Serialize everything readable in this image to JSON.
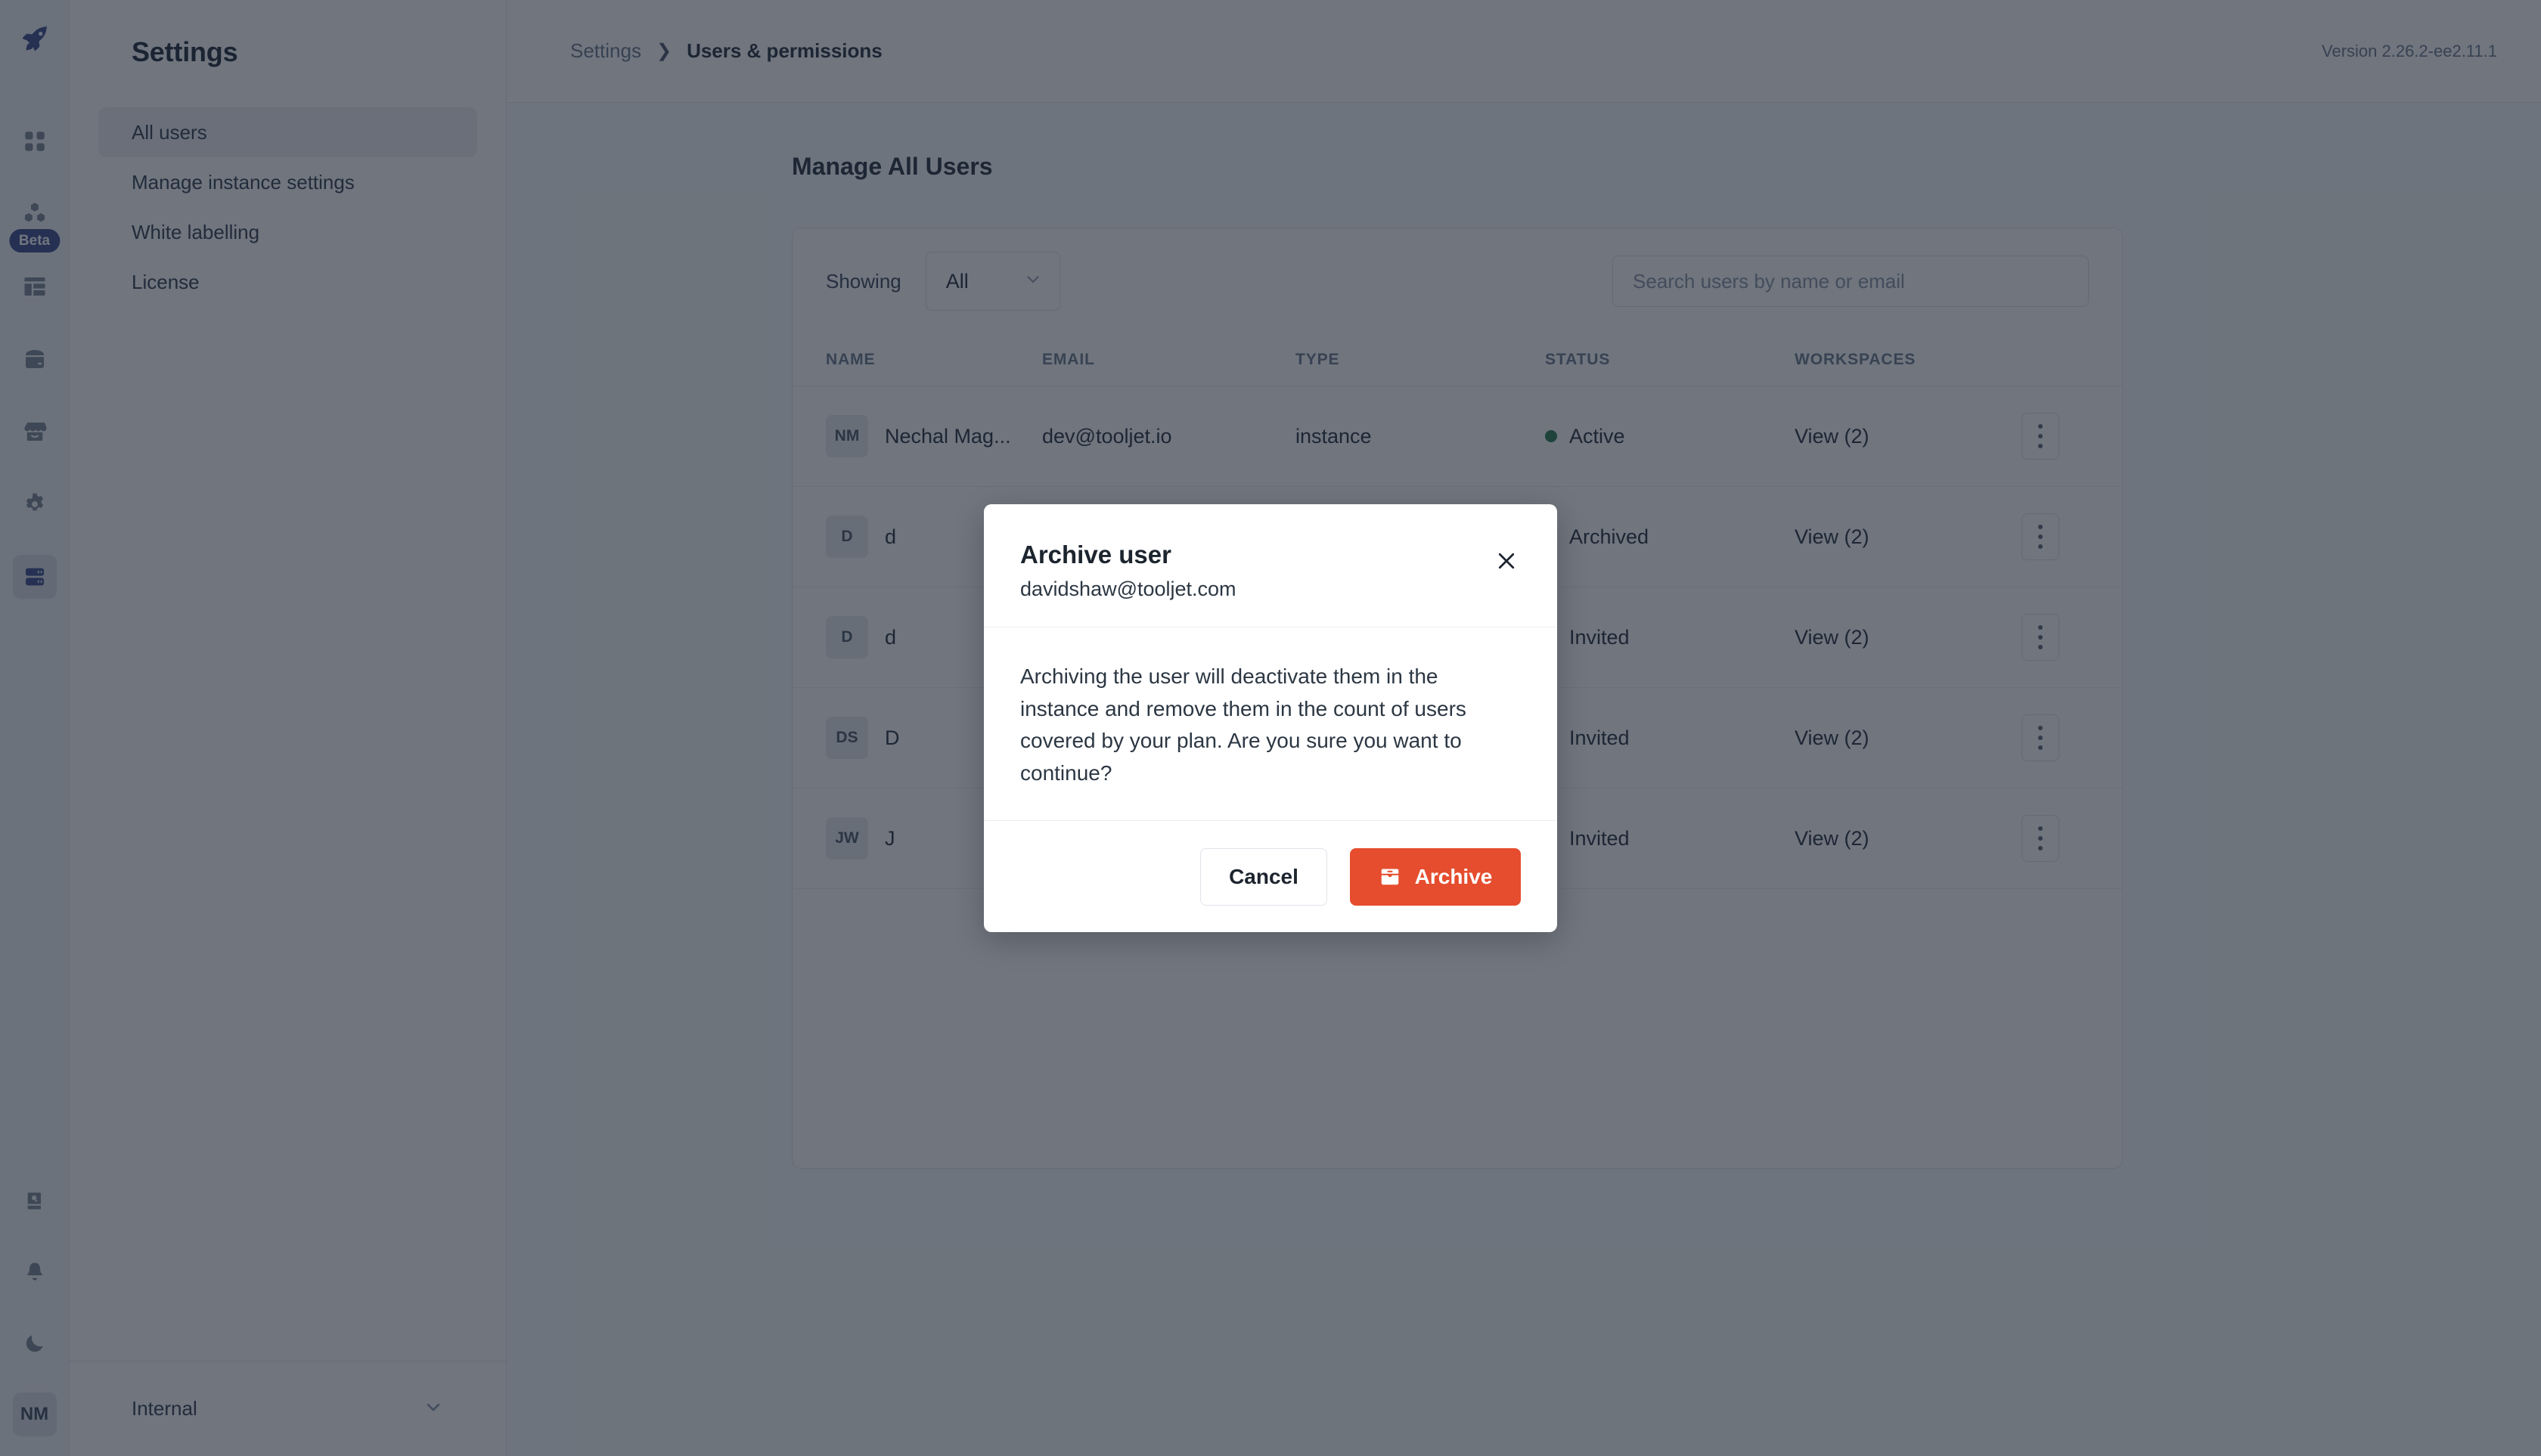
{
  "colors": {
    "brand_blue": "#3a4b8f",
    "accent_orange": "#e54d2e",
    "status_active": "#2a7d4f",
    "status_archived": "#a8333a",
    "status_invited": "#b07b24",
    "overlay": "#18212e"
  },
  "rail": {
    "logo_icon": "rocket-icon",
    "items": [
      {
        "icon": "grid-apps-icon",
        "active": false
      },
      {
        "icon": "hexagons-icon",
        "active": false,
        "badge": "Beta"
      },
      {
        "icon": "layout-dashboard-icon",
        "active": false
      },
      {
        "icon": "database-icon",
        "active": false
      },
      {
        "icon": "storefront-icon",
        "active": false
      },
      {
        "icon": "gear-icon",
        "active": false
      },
      {
        "icon": "server-rack-icon",
        "active": true
      }
    ],
    "bottom_items": [
      {
        "icon": "book-search-icon"
      },
      {
        "icon": "bell-icon"
      },
      {
        "icon": "moon-icon"
      }
    ],
    "avatar_initials": "NM"
  },
  "sidebar": {
    "title": "Settings",
    "items": [
      {
        "label": "All users",
        "active": true
      },
      {
        "label": "Manage instance settings",
        "active": false
      },
      {
        "label": "White labelling",
        "active": false
      },
      {
        "label": "License",
        "active": false
      }
    ],
    "workspace": {
      "name": "Internal",
      "chevron_icon": "chevron-down-icon"
    }
  },
  "topbar": {
    "breadcrumb_root": "Settings",
    "breadcrumb_separator": "❯",
    "breadcrumb_current": "Users & permissions",
    "version": "Version 2.26.2-ee2.11.1"
  },
  "main": {
    "page_title": "Manage All Users",
    "toolbar": {
      "showing_label": "Showing",
      "filter_value": "All",
      "filter_chevron_icon": "chevron-down-icon",
      "search_placeholder": "Search users by name or email",
      "search_value": ""
    },
    "table": {
      "columns": [
        "NAME",
        "EMAIL",
        "TYPE",
        "STATUS",
        "WORKSPACES"
      ],
      "rows": [
        {
          "initials": "NM",
          "name": "Nechal Mag...",
          "email": "dev@tooljet.io",
          "type": "instance",
          "status": "Active",
          "status_color": "#2a7d4f",
          "workspaces": "View (2)",
          "menu_icon": "kebab-menu-icon"
        },
        {
          "initials": "D",
          "name": "d",
          "email": "",
          "type": "",
          "status": "Archived",
          "status_color": "#a8333a",
          "workspaces": "View (2)",
          "menu_icon": "kebab-menu-icon"
        },
        {
          "initials": "D",
          "name": "d",
          "email": "",
          "type": "",
          "status": "Invited",
          "status_color": "#b07b24",
          "workspaces": "View (2)",
          "menu_icon": "kebab-menu-icon"
        },
        {
          "initials": "DS",
          "name": "D",
          "email": "",
          "type": "",
          "status": "Invited",
          "status_color": "#b07b24",
          "workspaces": "View (2)",
          "menu_icon": "kebab-menu-icon"
        },
        {
          "initials": "JW",
          "name": "J",
          "email": "",
          "type": "",
          "status": "Invited",
          "status_color": "#b07b24",
          "workspaces": "View (2)",
          "menu_icon": "kebab-menu-icon"
        }
      ]
    }
  },
  "modal": {
    "title": "Archive user",
    "subtitle": "davidshaw@tooljet.com",
    "close_icon": "close-icon",
    "body": "Archiving the user will deactivate them in the instance and remove them in the count of users covered by your plan. Are you sure you want to continue?",
    "cancel_label": "Cancel",
    "confirm_label": "Archive",
    "confirm_icon": "archive-box-icon"
  }
}
